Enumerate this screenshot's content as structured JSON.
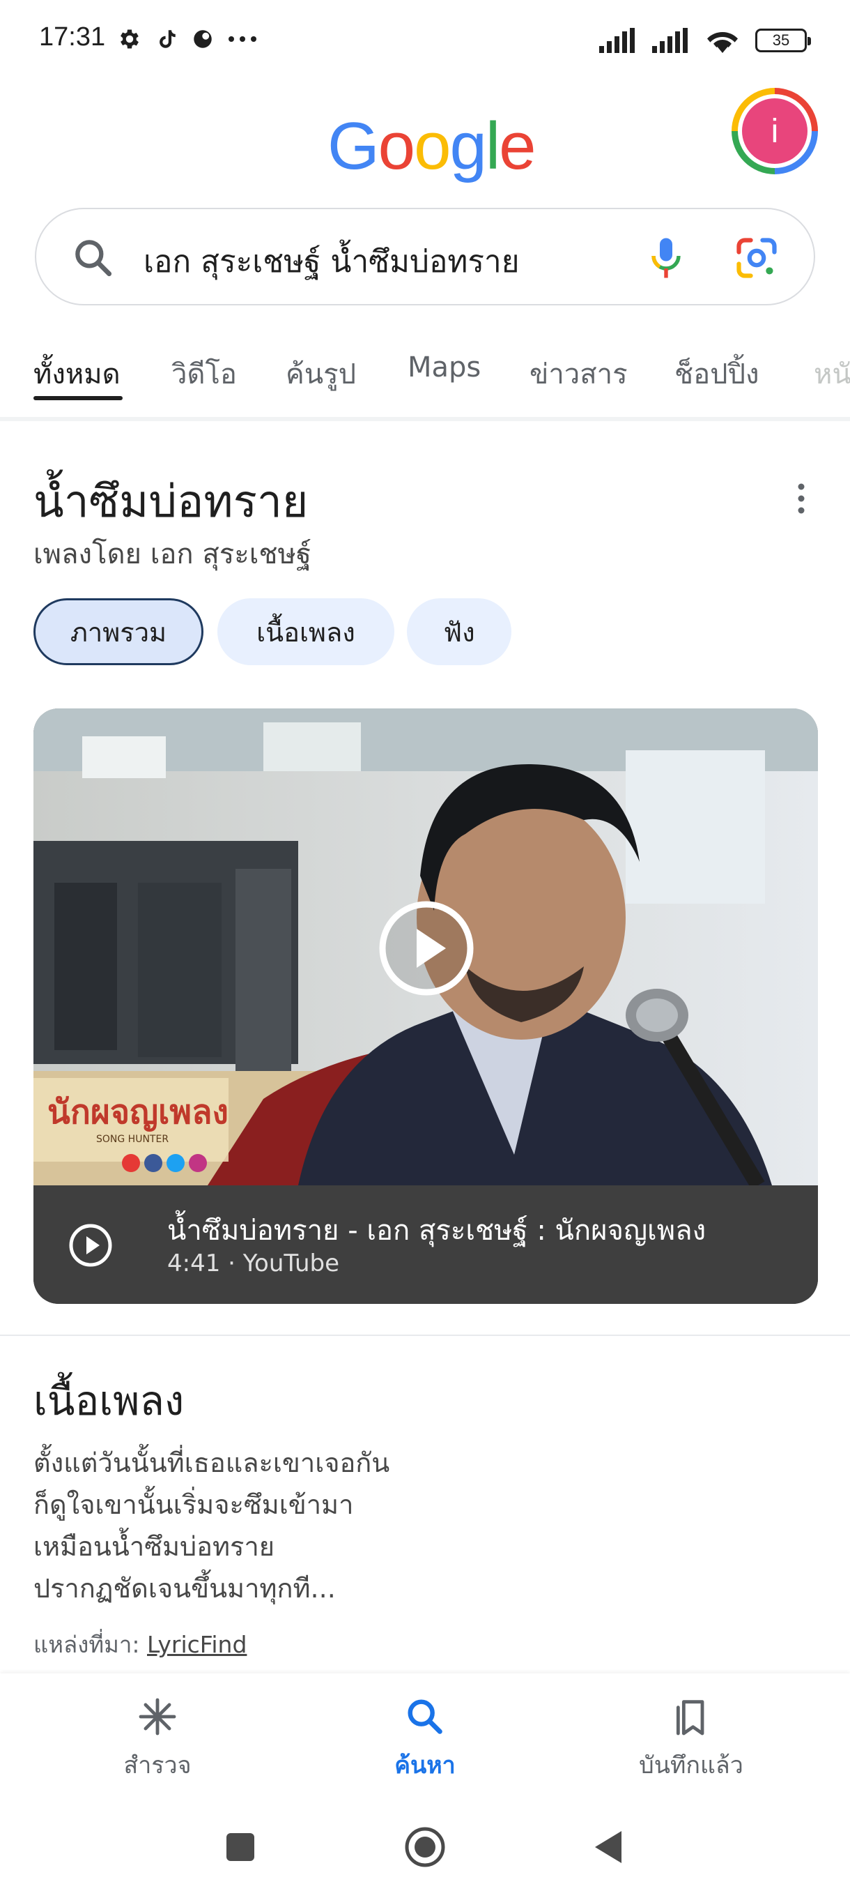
{
  "status_bar": {
    "time": "17:31",
    "battery": "35",
    "icons": [
      "gear-icon",
      "tiktok-icon",
      "app-icon",
      "more-dots-icon",
      "signal-icon",
      "signal-icon",
      "wifi-icon",
      "battery-icon"
    ]
  },
  "header": {
    "logo_letters": [
      "G",
      "o",
      "o",
      "g",
      "l",
      "e"
    ],
    "avatar_letter": "i"
  },
  "search": {
    "query": "เอก สุระเชษฐ์ น้ำซึมบ่อทราย"
  },
  "tabs": [
    {
      "label": "ทั้งหมด",
      "active": true
    },
    {
      "label": "วิดีโอ",
      "active": false
    },
    {
      "label": "ค้นรูป",
      "active": false
    },
    {
      "label": "Maps",
      "active": false
    },
    {
      "label": "ข่าวสาร",
      "active": false
    },
    {
      "label": "ช็อปปิ้ง",
      "active": false
    },
    {
      "label": "หนั",
      "active": false
    }
  ],
  "knowledge_panel": {
    "title": "น้ำซึมบ่อทราย",
    "subtitle": "เพลงโดย เอก สุระเชษฐ์",
    "chips": [
      {
        "label": "ภาพรวม",
        "active": true
      },
      {
        "label": "เนื้อเพลง",
        "active": false
      },
      {
        "label": "ฟัง",
        "active": false
      }
    ]
  },
  "video": {
    "title": "น้ำซึมบ่อทราย - เอก สุระเชษฐ์ : นักผจญเพลง",
    "meta": "4:41 · YouTube",
    "thumbnail_overlay": "นักผจญเพลง",
    "thumbnail_overlay_sub": "SONG HUNTER"
  },
  "lyrics": {
    "heading": "เนื้อเพลง",
    "lines": [
      "ตั้งแต่วันนั้นที่เธอและเขาเจอกัน",
      "ก็ดูใจเขานั้นเริ่มจะซึมเข้ามา",
      "เหมือนน้ำซึมบ่อทราย",
      "ปรากฏชัดเจนขึ้นมาทุกที..."
    ],
    "source_prefix": "แหล่งที่มา: ",
    "source_link": "LyricFind"
  },
  "bottom_nav": [
    {
      "label": "สำรวจ",
      "icon": "asterisk-icon",
      "active": false
    },
    {
      "label": "ค้นหา",
      "icon": "search-icon",
      "active": true
    },
    {
      "label": "บันทึกแล้ว",
      "icon": "bookmarks-icon",
      "active": false
    }
  ],
  "system_nav": [
    "recents-button",
    "home-button",
    "back-button"
  ],
  "colors": {
    "google_blue": "#4285f4",
    "google_red": "#ea4335",
    "google_yellow": "#fbbc05",
    "google_green": "#34a853",
    "active_nav": "#1a73e8",
    "chip_bg": "#e8f0fe",
    "avatar_bg": "#e8457c"
  }
}
